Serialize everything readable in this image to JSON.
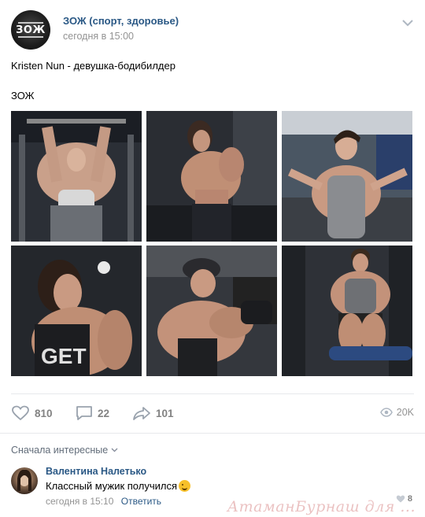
{
  "post": {
    "group_name": "ЗОЖ (спорт, здоровье)",
    "avatar_text": "ЗОЖ",
    "time": "сегодня в 15:00",
    "text_line1": "Kristen Nun - девушка-бодибилдер",
    "text_line2": "ЗОЖ",
    "photos": [
      {
        "icon": "photo-gym-arms-up"
      },
      {
        "icon": "photo-gym-side-pose"
      },
      {
        "icon": "photo-gym-smiling"
      },
      {
        "icon": "photo-gym-closeup"
      },
      {
        "icon": "photo-gym-cap-biceps"
      },
      {
        "icon": "photo-gym-leg-machine"
      }
    ]
  },
  "actions": {
    "likes": "810",
    "comments": "22",
    "shares": "101",
    "views": "20K"
  },
  "comments_section": {
    "sort_label": "Сначала интересные",
    "items": [
      {
        "author": "Валентина Налетько",
        "text": "Классный мужик получился",
        "time": "сегодня в 15:10",
        "reply_label": "Ответить",
        "likes": "8"
      }
    ]
  },
  "watermark": "АтаманБурнаш для ...",
  "colors": {
    "link": "#2a5885",
    "muted": "#939393",
    "separator": "#e7e8ec"
  }
}
